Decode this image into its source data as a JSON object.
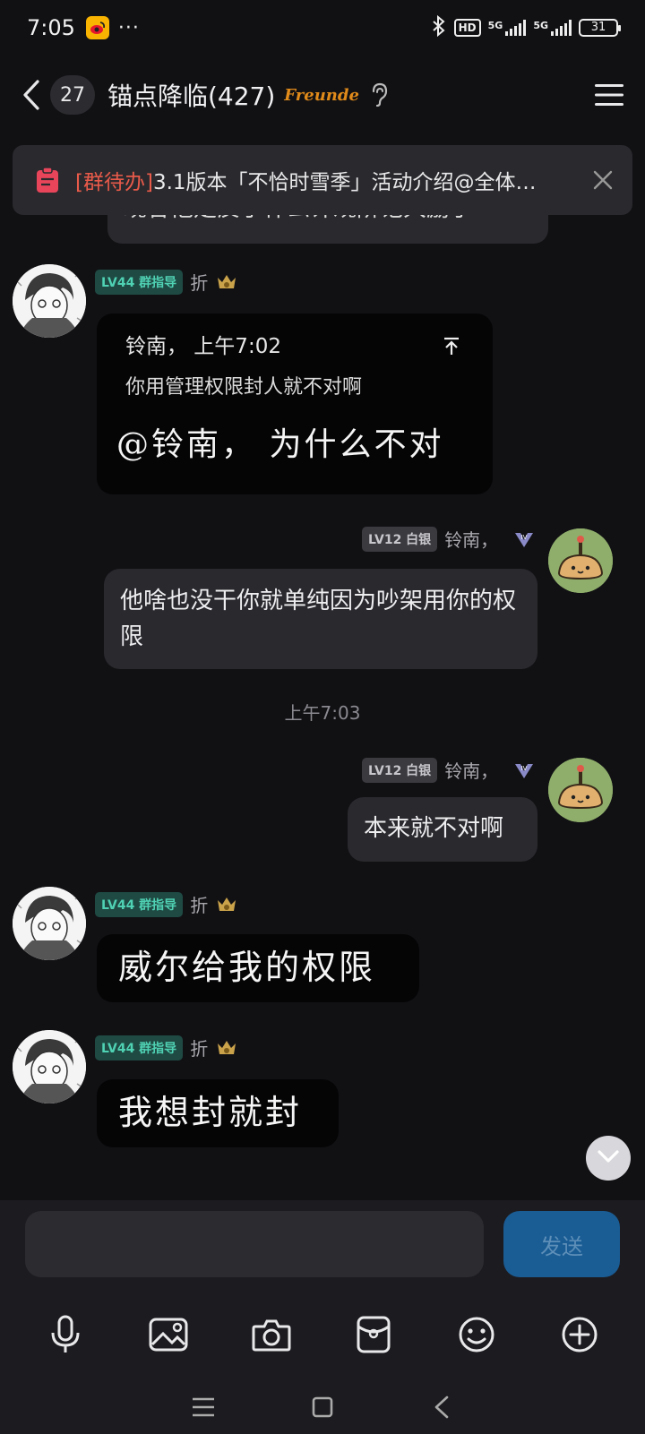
{
  "status_bar": {
    "time": "7:05",
    "more": "···",
    "hd": "HD",
    "net1": "5G",
    "net2": "5G",
    "battery": "31"
  },
  "header": {
    "unread": "27",
    "title": "锚点降临(427)",
    "badge": "Freunde"
  },
  "pinned": {
    "tag": "[群待办]",
    "text": "3.1版本「不恰时雪季」活动介绍@全体…"
  },
  "previous_message_fragment": "现各他走反了什么计观阶记大励了",
  "messages": [
    {
      "side": "left",
      "level": "LV44 群指导",
      "name": "折",
      "quote_author": "铃南，  上午7:02",
      "quote_text": "你用管理权限封人就不对啊",
      "text": "@铃南，  为什么不对"
    },
    {
      "side": "right",
      "level": "LV12 白银",
      "name": "铃南，",
      "text": "他啥也没干你就单纯因为吵架用你的权限"
    },
    {
      "timestamp": "上午7:03"
    },
    {
      "side": "right",
      "level": "LV12 白银",
      "name": "铃南，",
      "text": "本来就不对啊"
    },
    {
      "side": "left",
      "level": "LV44 群指导",
      "name": "折",
      "text": "威尔给我的权限"
    },
    {
      "side": "left",
      "level": "LV44 群指导",
      "name": "折",
      "text": "我想封就封"
    }
  ],
  "composer": {
    "input_value": "",
    "send_label": "发送"
  },
  "colors": {
    "background": "#111114",
    "bubble": "#2a2a2e",
    "accent_red": "#e85a4a",
    "send_blue": "#1a5c94",
    "level_green": "#4fd1b3"
  },
  "icons": [
    "back-icon",
    "ear-icon",
    "menu-icon",
    "todo-icon",
    "close-icon",
    "mic-icon",
    "image-icon",
    "camera-icon",
    "red-packet-icon",
    "emoji-icon",
    "plus-icon",
    "chevron-down-icon"
  ]
}
